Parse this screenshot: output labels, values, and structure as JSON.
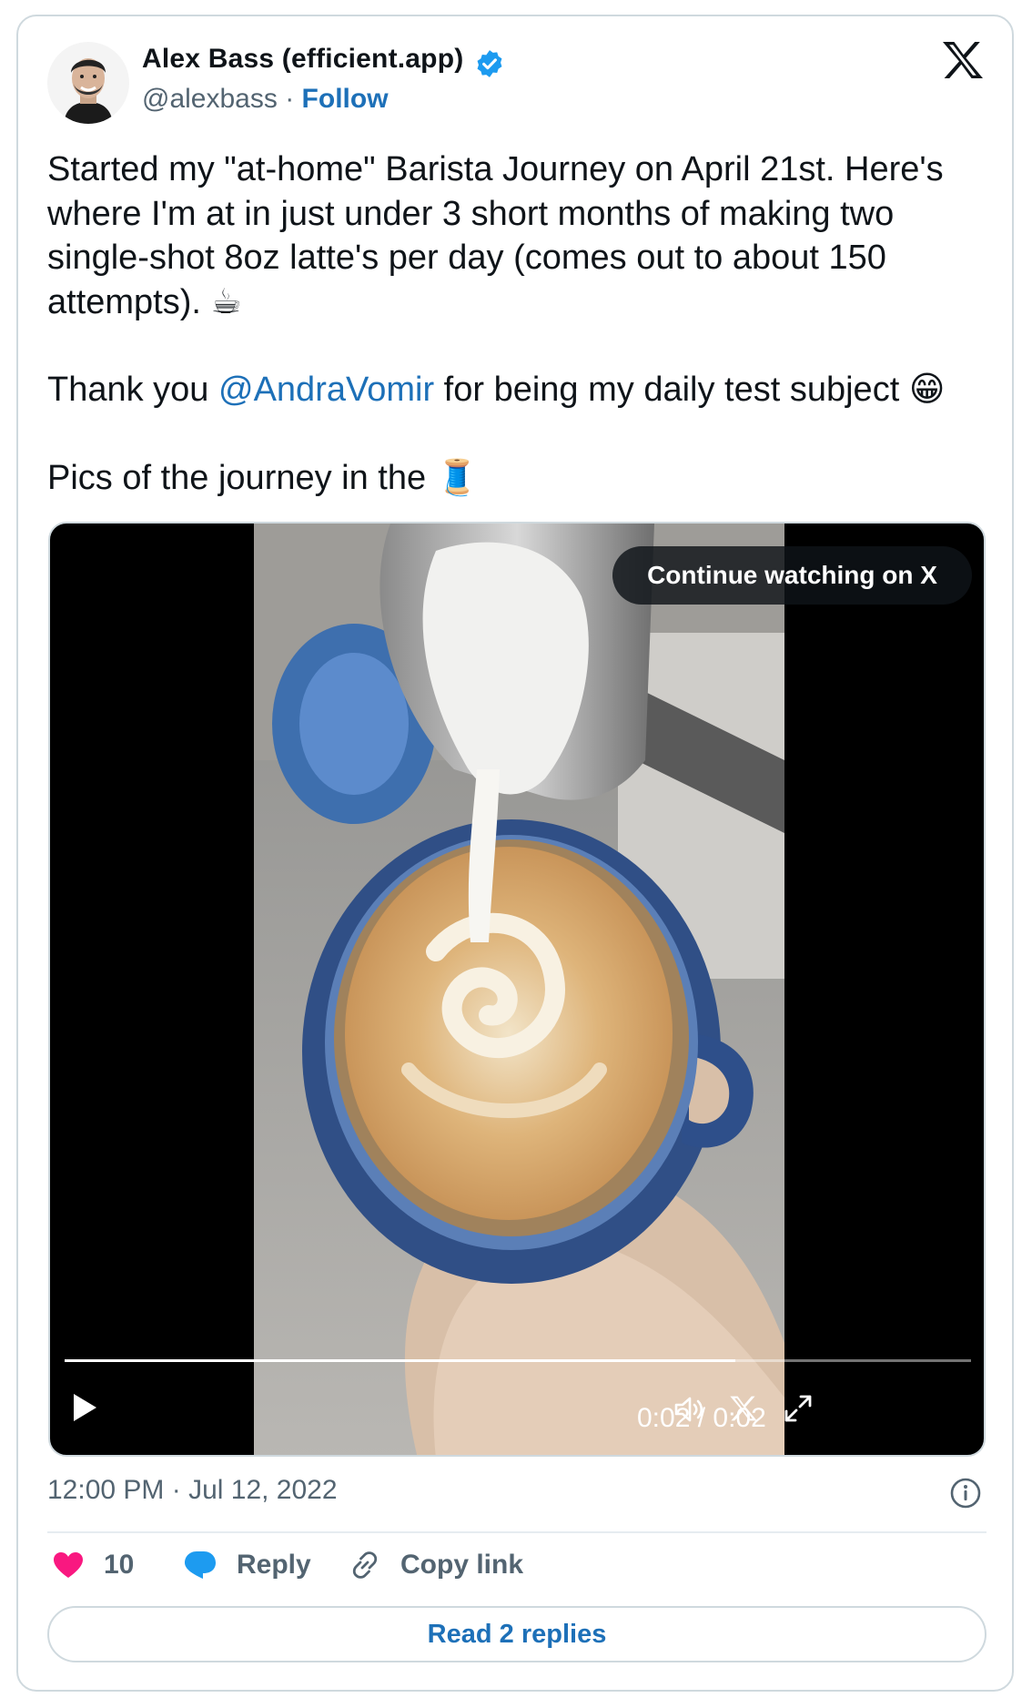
{
  "author": {
    "name": "Alex Bass (efficient.app)",
    "handle": "@alexbass",
    "separator": "·",
    "follow_label": "Follow"
  },
  "tweet": {
    "paragraph1": "Started my \"at-home\" Barista Journey on April 21st. Here's where I'm at in just under 3 short months of making two single-shot 8oz latte's per day (comes out to about 150 attempts).",
    "emoji1": "☕",
    "p2_before": "Thank you ",
    "mention": "@AndraVomir",
    "p2_after": " for being my daily test subject",
    "emoji2": "😁",
    "paragraph3": "Pics of the journey in the",
    "emoji3": "🧵"
  },
  "video": {
    "continue_label": "Continue watching on X",
    "time_display": "0:02 / 0:02",
    "progress": 0.74
  },
  "timestamp": "12:00 PM · Jul 12, 2022",
  "actions": {
    "likes": "10",
    "reply_label": "Reply",
    "copy_label": "Copy link"
  },
  "read_replies_label": "Read 2 replies",
  "colors": {
    "accent": "#1d70b8",
    "verified": "#1d9bf0",
    "like": "#f91880",
    "muted": "#536471",
    "border": "#cfd9de"
  },
  "icons": [
    "verified-badge-icon",
    "x-logo-icon",
    "play-icon",
    "volume-icon",
    "fullscreen-icon",
    "info-icon",
    "heart-icon",
    "reply-bubble-icon",
    "link-icon"
  ]
}
